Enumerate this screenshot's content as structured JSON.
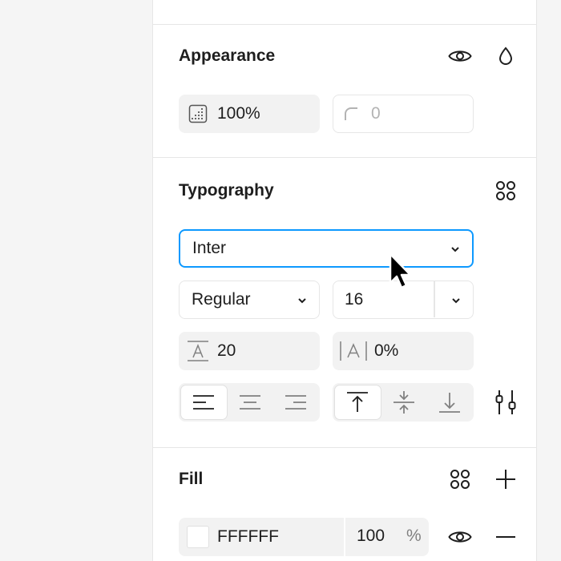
{
  "appearance": {
    "title": "Appearance",
    "opacity_value": "100%",
    "corner_radius_value": "0",
    "icons": [
      "eye-icon",
      "drop-icon",
      "opacity-icon",
      "corner-radius-icon"
    ]
  },
  "typography": {
    "title": "Typography",
    "font_family": "Inter",
    "font_weight": "Regular",
    "font_size": "16",
    "line_height": "20",
    "letter_spacing": "0%",
    "icons": [
      "styles-grid-icon",
      "chevron-down-icon",
      "line-height-icon",
      "letter-spacing-icon",
      "align-left-icon",
      "align-center-icon",
      "align-right-icon",
      "align-top-icon",
      "align-middle-icon",
      "align-bottom-icon",
      "type-settings-icon"
    ]
  },
  "fill": {
    "title": "Fill",
    "hex": "FFFFFF",
    "opacity": "100",
    "opacity_unit": "%",
    "icons": [
      "styles-grid-icon",
      "plus-icon",
      "eye-icon",
      "minus-icon"
    ]
  },
  "colors": {
    "focus": "#0d99ff",
    "field_bg": "#f2f2f2",
    "border": "#e6e6e6",
    "text": "#1e1e1e",
    "muted": "#b3b3b3"
  }
}
